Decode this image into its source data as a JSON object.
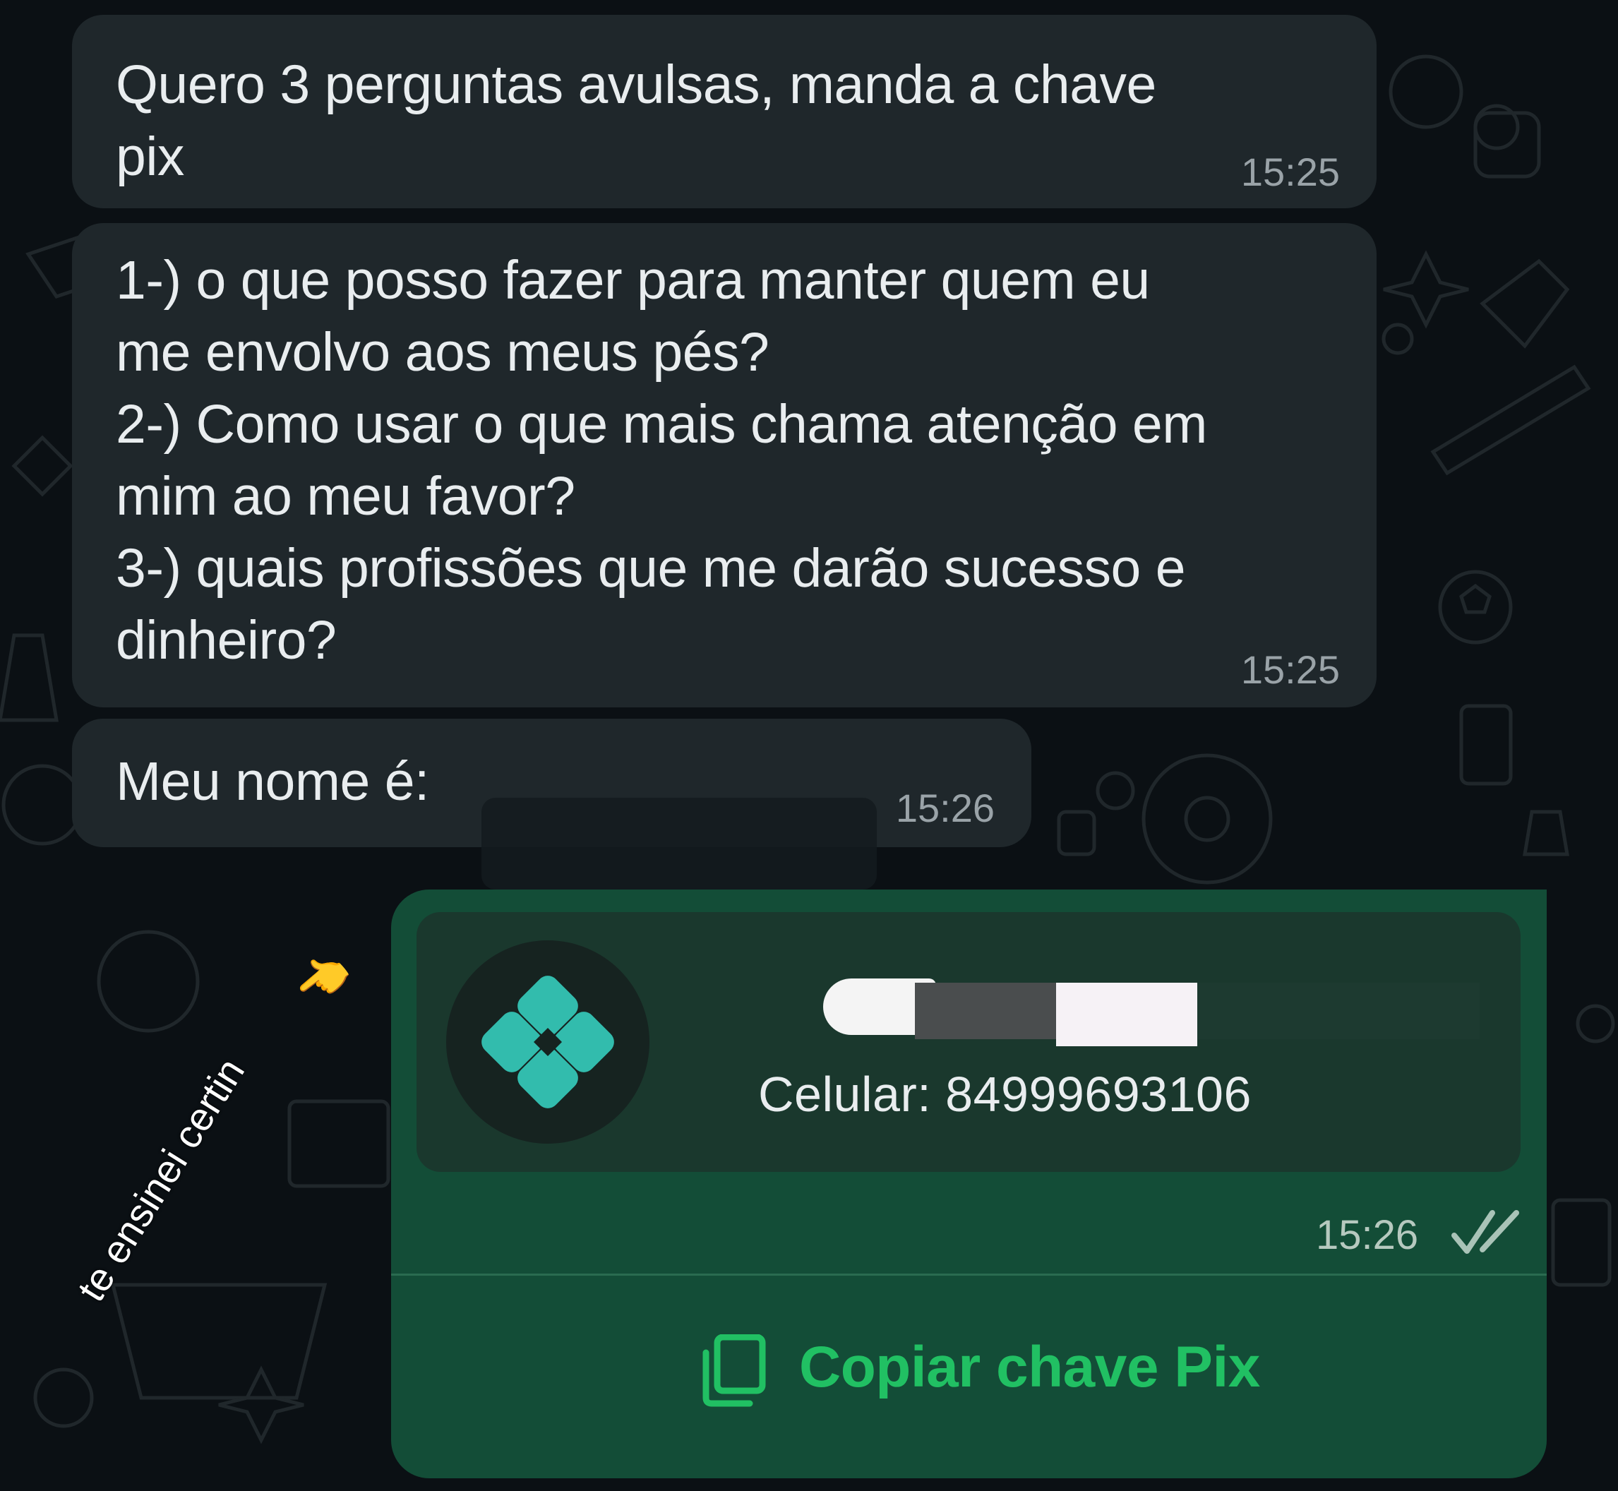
{
  "messages": [
    {
      "text": "Quero 3 perguntas avulsas, manda a chave\npix",
      "time": "15:25"
    },
    {
      "text": "1-) o que posso fazer para manter quem eu\nme envolvo aos meus pés?\n2-) Como usar o que mais chama atenção em\nmim ao meu favor?\n3-) quais profissões que me darão sucesso e\ndinheiro?",
      "time": "15:25"
    },
    {
      "text": "Meu nome é:",
      "time": "15:26"
    }
  ],
  "pix_message": {
    "icon": "pix-logo-icon",
    "phone": "Celular: 84999693106",
    "time": "15:26",
    "status_icon": "double-check-icon",
    "copy_label": "Copiar chave Pix",
    "copy_icon": "copy-icon"
  },
  "sticker": {
    "text": "te ensinei certin",
    "emoji": "👈"
  },
  "colors": {
    "background": "#0b1014",
    "incoming_bubble": "#1f272b",
    "outgoing_bubble": "#134d37",
    "pix_card": "#1a382d",
    "accent_green": "#21c063",
    "pix_teal": "#32bcad"
  }
}
